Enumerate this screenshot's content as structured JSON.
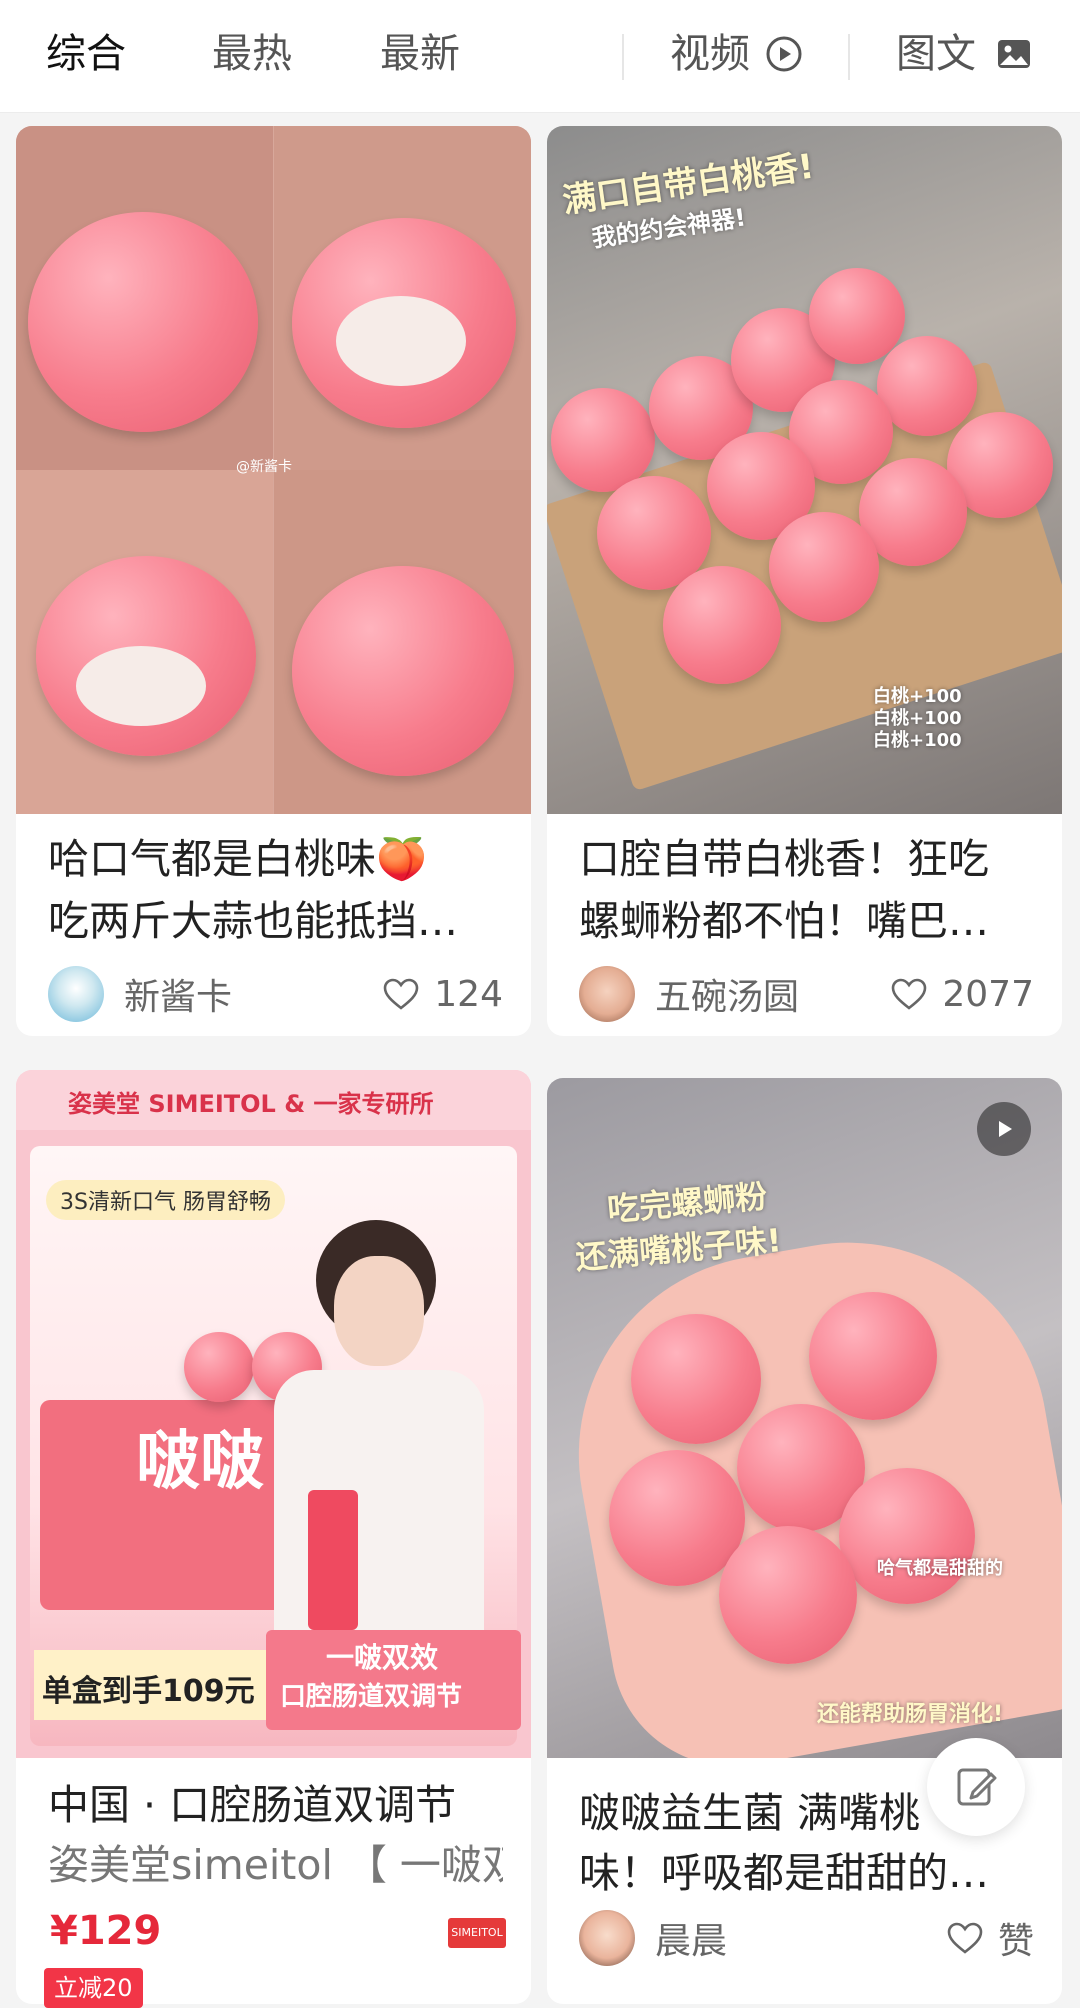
{
  "tabs": {
    "comprehensive": "综合",
    "hottest": "最热",
    "newest": "最新",
    "video": "视频",
    "image_text": "图文"
  },
  "cards": [
    {
      "title_line1": "哈口气都是白桃味🍑",
      "title_line2": "吃两斤大蒜也能抵挡…",
      "author": "新酱卡",
      "likes": "124",
      "watermark": "@新酱卡"
    },
    {
      "title_line1": "口腔自带白桃香！狂吃",
      "title_line2": "螺蛳粉都不怕！嘴巴…",
      "author": "五碗汤圆",
      "likes": "2077",
      "overlay_line1": "满口自带白桃香!",
      "overlay_line2": "我的约会神器!",
      "overlay_tag": "白桃+100"
    },
    {
      "title_line1": "中国 · 口腔肠道双调节",
      "title_line2": "姿美堂simeitol 【 一啵双…",
      "price": "¥129",
      "coupon": "立减20",
      "banner": "姿美堂 SIMEITOL & 一家专研所",
      "badge_text": "3S清新口气  肠胃舒畅",
      "product_name": "啵啵",
      "promo_line": "单盒到手109元",
      "promo_sub1": "一啵双效",
      "promo_sub2": "口腔肠道双调节",
      "brand_small": "SIMEITOL"
    },
    {
      "title_line1": "啵啵益生菌 满嘴桃",
      "title_line2": "味！呼吸都是甜甜的…",
      "author": "晨晨",
      "likes": "赞",
      "overlay_line1": "吃完螺蛳粉",
      "overlay_line2": "还满嘴桃子味!",
      "overlay_note": "哈气都是甜甜的",
      "overlay_bottom": "还能帮助肠胃消化!"
    }
  ],
  "colors": {
    "accent": "#e5283a",
    "peach": "#f77c8c"
  }
}
